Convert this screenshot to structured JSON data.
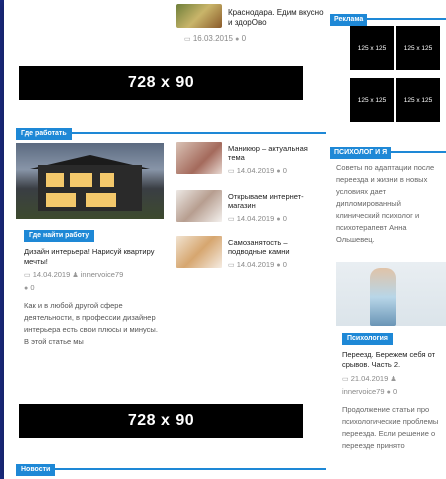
{
  "top_teaser": {
    "title": "Краснодара. Едим вкусно и здорОво",
    "date": "16.03.2015",
    "comments": "0"
  },
  "banners": {
    "top": "728 x 90",
    "bottom": "728 x 90"
  },
  "sections": {
    "work": "Где работать",
    "news": "Новости"
  },
  "featured": {
    "category": "Где найти работу",
    "title": "Дизайн интерьера! Нарисуй квартиру мечты!",
    "date": "14.04.2019",
    "author": "innervoice79",
    "comments": "0",
    "excerpt": "Как и в любой другой сфере деятельности, в профессии дизайнер интерьера есть свои плюсы и минусы. В этой статье мы"
  },
  "list": [
    {
      "title": "Маникюр – актуальная тема",
      "date": "14.04.2019",
      "comments": "0"
    },
    {
      "title": "Открываем интернет-магазин",
      "date": "14.04.2019",
      "comments": "0"
    },
    {
      "title": "Самозанятость – подводные камни",
      "date": "14.04.2019",
      "comments": "0"
    }
  ],
  "sidebar": {
    "ads_head": "Реклама",
    "ads": [
      "125 x 125",
      "125 x 125",
      "125 x 125",
      "125 x 125"
    ],
    "psych_head": "ПСИХОЛОГ И Я",
    "psych_text": "Советы по адаптации после переезда и жизни в новых условиях дает дипломированный клинический психолог и психотерапевт Анна Ольшевец.",
    "post": {
      "category": "Психология",
      "title": "Переезд. Бережем себя от срывов. Часть 2.",
      "date": "21.04.2019",
      "author": "innervoice79",
      "comments": "0",
      "excerpt": "Продолжение статьи про психологические проблемы переезда. Если решение о переезде принято"
    }
  },
  "colors": {
    "accent": "#1e88d6",
    "background": "#1b2c86"
  }
}
